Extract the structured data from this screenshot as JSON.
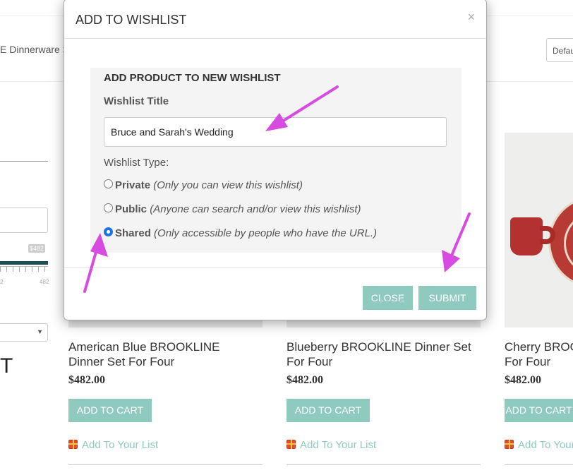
{
  "page": {
    "breadcrumb": "E Dinnerware >",
    "sort_value": "Defau",
    "price_max_bubble": "$482",
    "tick_left": "2",
    "tick_right": "482",
    "sidebar_heading_fragment": "T",
    "products": [
      {
        "title_line1": "American Blue BROOKLINE",
        "title_line2": "Dinner Set For Four",
        "price": "$482.00",
        "cart_label": "ADD TO CART",
        "wishlist_link": "Add To Your List"
      },
      {
        "title_line1": "Blueberry BROOKLINE Dinner Set",
        "title_line2": "For Four",
        "price": "$482.00",
        "cart_label": "ADD TO CART",
        "wishlist_link": "Add To Your List"
      },
      {
        "title_line1": "Cherry BROOKLINE",
        "title_line2": "For Four",
        "price": "$482.00",
        "cart_label": "ADD TO CART",
        "wishlist_link": "Add To Your List"
      }
    ]
  },
  "modal": {
    "title": "ADD TO WISHLIST",
    "close_glyph": "×",
    "heading": "ADD PRODUCT TO NEW WISHLIST",
    "title_label": "Wishlist Title",
    "title_value": "Bruce and Sarah's Wedding",
    "type_label": "Wishlist Type:",
    "options": [
      {
        "name": "Private",
        "description": "(Only you can view this wishlist)",
        "selected": false
      },
      {
        "name": "Public",
        "description": "(Anyone can search and/or view this wishlist)",
        "selected": false
      },
      {
        "name": "Shared",
        "description": "(Only accessible by people who have the URL.)",
        "selected": true
      }
    ],
    "close_button": "CLOSE",
    "submit_button": "SUBMIT"
  },
  "colors": {
    "accent": "#8ecabe",
    "annotation_arrow": "#d64be0",
    "slider": "#1c4f57"
  }
}
